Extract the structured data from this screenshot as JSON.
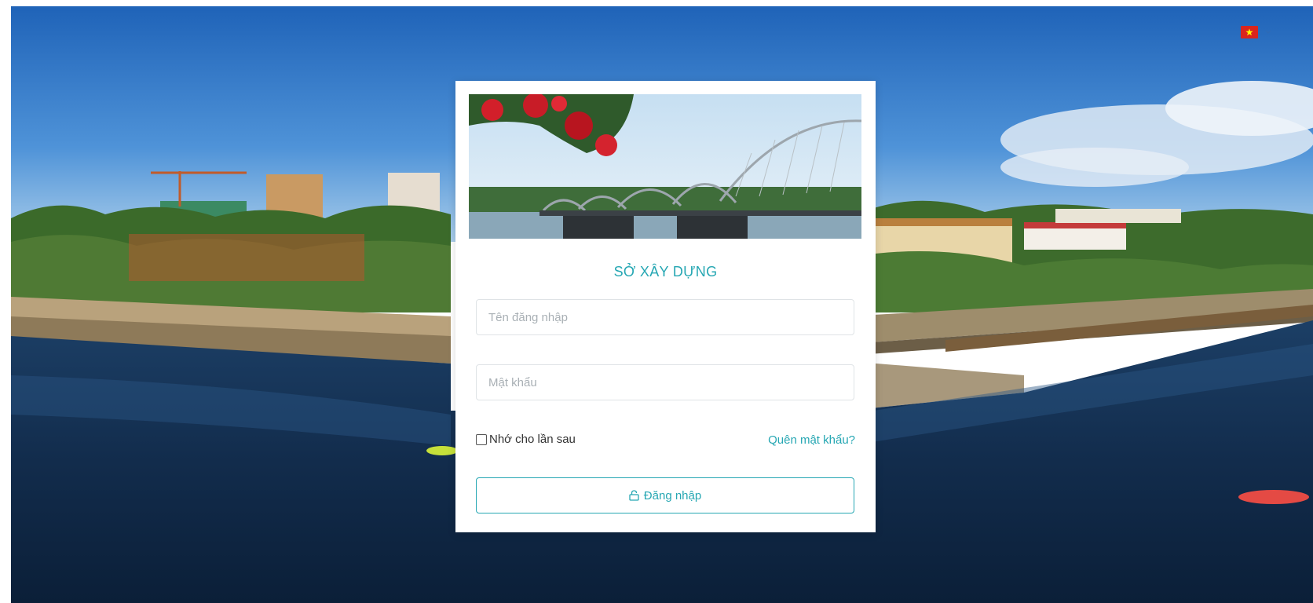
{
  "header": {
    "language_flag_icon": "vietnam-flag-icon",
    "language_caret_icon": "chevron-down-icon"
  },
  "login": {
    "title": "SỞ XÂY DỰNG",
    "username_placeholder": "Tên đăng nhập",
    "password_placeholder": "Mật khẩu",
    "remember_label": "Nhớ cho lần sau",
    "forgot_label": "Quên mật khẩu?",
    "submit_label": "Đăng nhập",
    "submit_icon": "lock-icon"
  },
  "colors": {
    "accent": "#26a7b3",
    "flag_red": "#da251d",
    "flag_star": "#ffff00"
  }
}
